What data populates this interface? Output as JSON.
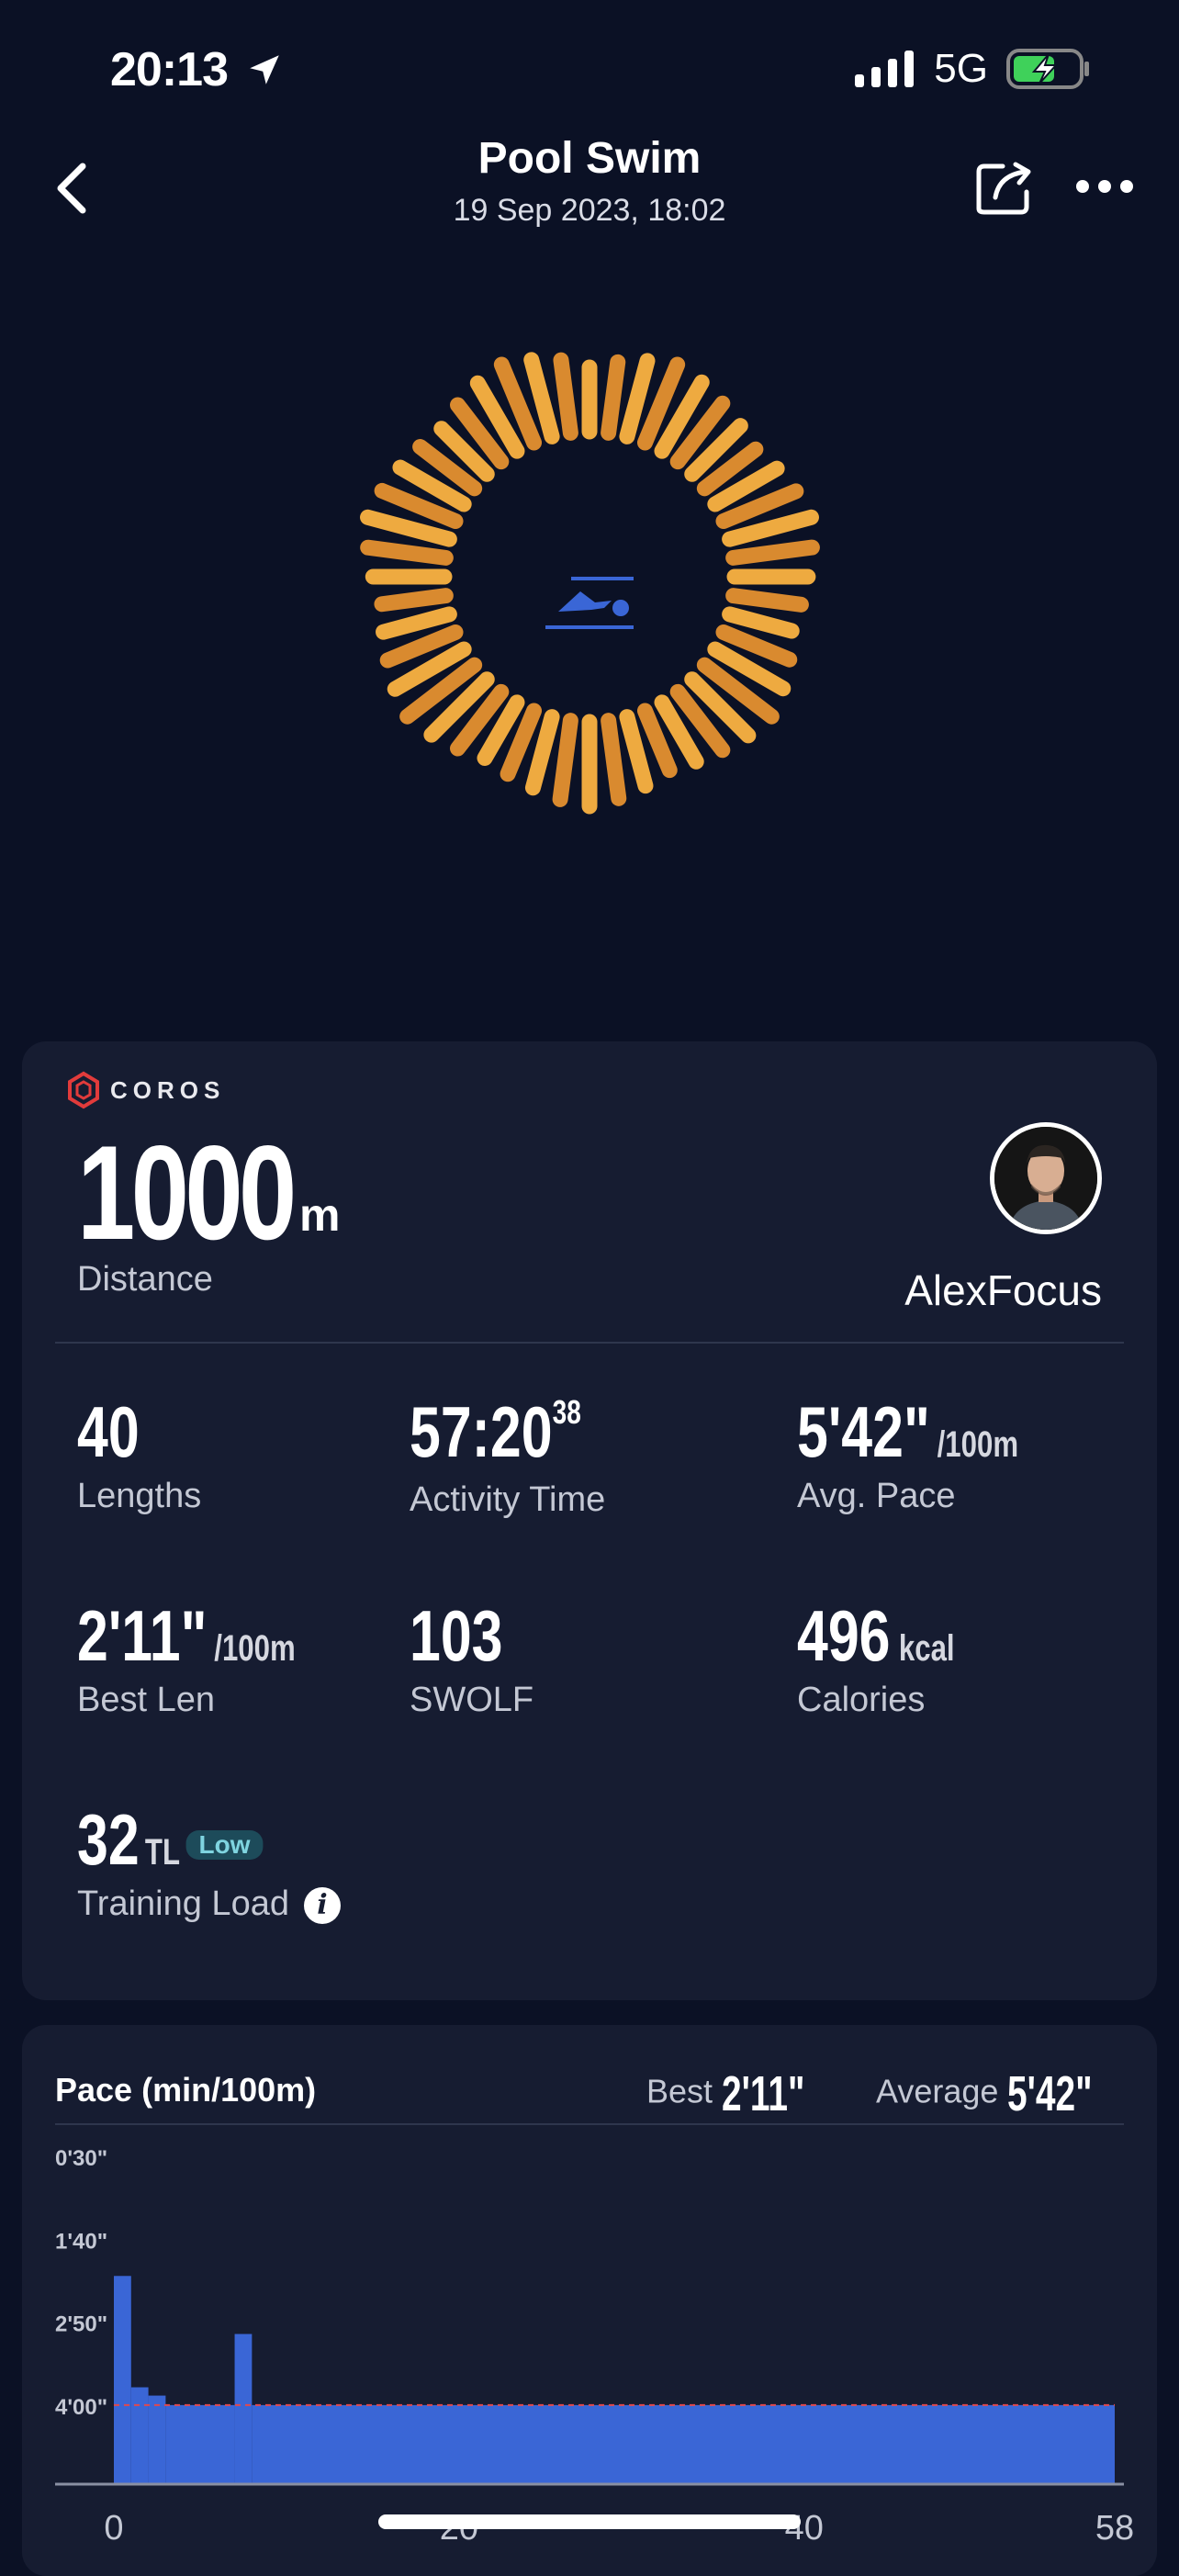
{
  "status_bar": {
    "time": "20:13",
    "network": "5G"
  },
  "header": {
    "title": "Pool Swim",
    "subtitle": "19 Sep 2023, 18:02"
  },
  "card": {
    "brand": "COROS",
    "distance": {
      "value": "1000",
      "unit": "m",
      "label": "Distance"
    },
    "user": "AlexFocus",
    "metrics": {
      "lengths": {
        "value": "40",
        "label": "Lengths"
      },
      "activity_time": {
        "value": "57:20",
        "sup": "38",
        "label": "Activity Time"
      },
      "avg_pace": {
        "value": "5'42\"",
        "unit": "/100m",
        "label": "Avg. Pace"
      },
      "best_len": {
        "value": "2'11\"",
        "unit": "/100m",
        "label": "Best Len"
      },
      "swolf": {
        "value": "103",
        "label": "SWOLF"
      },
      "calories": {
        "value": "496",
        "unit": "kcal",
        "label": "Calories"
      },
      "training_load": {
        "value": "32",
        "unit": "TL",
        "badge": "Low",
        "label": "Training Load"
      }
    }
  },
  "pace_chart": {
    "title": "Pace (min/100m)",
    "best_label": "Best",
    "best_value": "2'11\"",
    "avg_label": "Average",
    "avg_value": "5'42\""
  },
  "chart_data": {
    "type": "bar",
    "title": "Pace (min/100m)",
    "y_tick_labels": [
      "0'30\"",
      "1'40\"",
      "2'50\"",
      "4'00\""
    ],
    "x_tick_labels": [
      "0",
      "20",
      "40",
      "58"
    ],
    "ylim_seconds": [
      30,
      260
    ],
    "x_range": [
      0,
      58
    ],
    "average_line_seconds": 240,
    "segments": [
      {
        "x_start": 0,
        "x_end": 1,
        "pace_seconds": 131
      },
      {
        "x_start": 1,
        "x_end": 2,
        "pace_seconds": 225
      },
      {
        "x_start": 2,
        "x_end": 3,
        "pace_seconds": 232
      },
      {
        "x_start": 3,
        "x_end": 7,
        "pace_seconds": 240
      },
      {
        "x_start": 7,
        "x_end": 8,
        "pace_seconds": 180
      },
      {
        "x_start": 8,
        "x_end": 58,
        "pace_seconds": 240
      }
    ],
    "colors": {
      "bar": "#3a66d6",
      "avg_line": "#e0484e",
      "grid": "#2e364d"
    }
  },
  "colors": {
    "accent_orange": "#e8a23a",
    "accent_blue": "#3a66d6",
    "brand_red": "#e23b3b"
  }
}
